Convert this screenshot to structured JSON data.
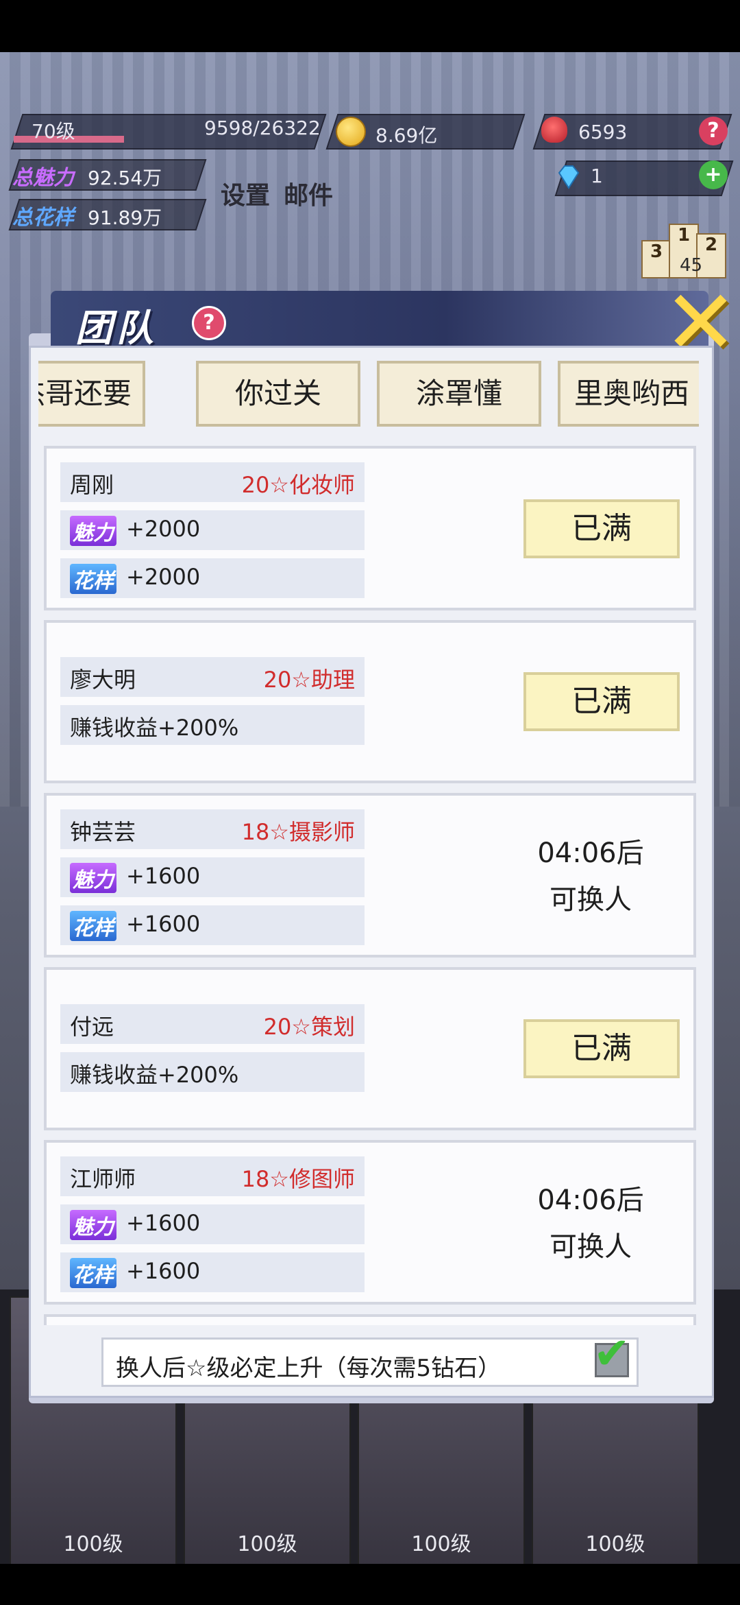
{
  "hud": {
    "level": "70级",
    "exp": "9598/26322",
    "exp_progress": 0.365,
    "coins": "8.69亿",
    "roses": "6593",
    "diamonds": "1",
    "help": "?",
    "add": "+",
    "charm_label": "总魅力",
    "charm_value": "92.54万",
    "style_label": "总花样",
    "style_value": "91.89万",
    "settings": "设置",
    "mail": "邮件",
    "rank_badge": "45",
    "podium": [
      "3",
      "1",
      "2"
    ]
  },
  "panel": {
    "title": "团队",
    "help": "?",
    "close": "✕",
    "tabs": [
      "杰哥还要",
      "你过关",
      "涂罩懂",
      "里奥哟西"
    ],
    "members": [
      {
        "name": "周刚",
        "role": "20☆化妆师",
        "charm": "+2000",
        "style": "+2000",
        "action": "已满"
      },
      {
        "name": "廖大明",
        "role": "20☆助理",
        "income": "赚钱收益+200%",
        "action": "已满"
      },
      {
        "name": "钟芸芸",
        "role": "18☆摄影师",
        "charm": "+1600",
        "style": "+1600",
        "timer": "04:06后",
        "timer_sub": "可换人"
      },
      {
        "name": "付远",
        "role": "20☆策划",
        "income": "赚钱收益+200%",
        "action": "已满"
      },
      {
        "name": "江师师",
        "role": "18☆修图师",
        "charm": "+1600",
        "style": "+1600",
        "timer": "04:06后",
        "timer_sub": "可换人"
      }
    ],
    "attr_charm": "魅力",
    "attr_style": "花样",
    "footer": "换人后☆级必定上升（每次需5钻石）",
    "footer_checked": true
  },
  "characters": [
    {
      "level": "100级"
    },
    {
      "level": "100级"
    },
    {
      "level": "100级"
    },
    {
      "level": "100级"
    }
  ]
}
